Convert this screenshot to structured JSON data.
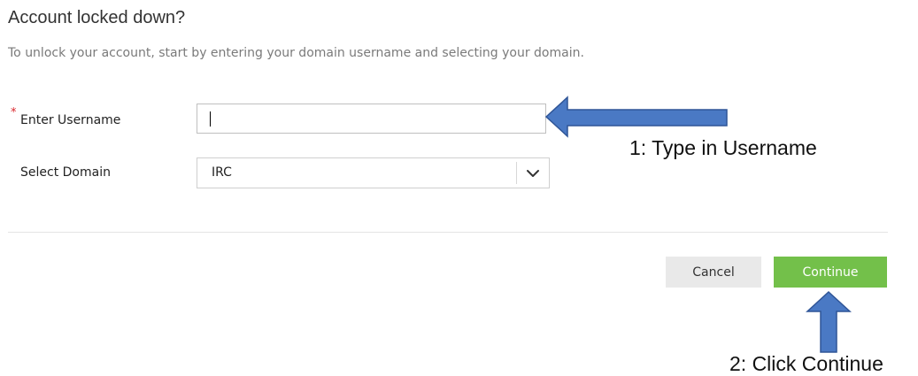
{
  "header": {
    "title": "Account locked down?",
    "subtitle": "To unlock your account, start by entering your domain username and selecting your domain."
  },
  "form": {
    "username": {
      "required_marker": "*",
      "label": "Enter Username",
      "value": ""
    },
    "domain": {
      "label": "Select Domain",
      "selected": "IRC"
    }
  },
  "actions": {
    "cancel_label": "Cancel",
    "continue_label": "Continue"
  },
  "annotations": {
    "step1": "1: Type in Username",
    "step2": "2: Click Continue"
  },
  "colors": {
    "continue_button": "#73c04a",
    "cancel_button": "#e9e9e9",
    "required_marker": "#d9262c",
    "annotation_arrow": "#4a79c4"
  },
  "icons": {
    "dropdown": "chevron-down-icon",
    "arrow_left": "left-arrow-icon",
    "arrow_up": "up-arrow-icon"
  }
}
